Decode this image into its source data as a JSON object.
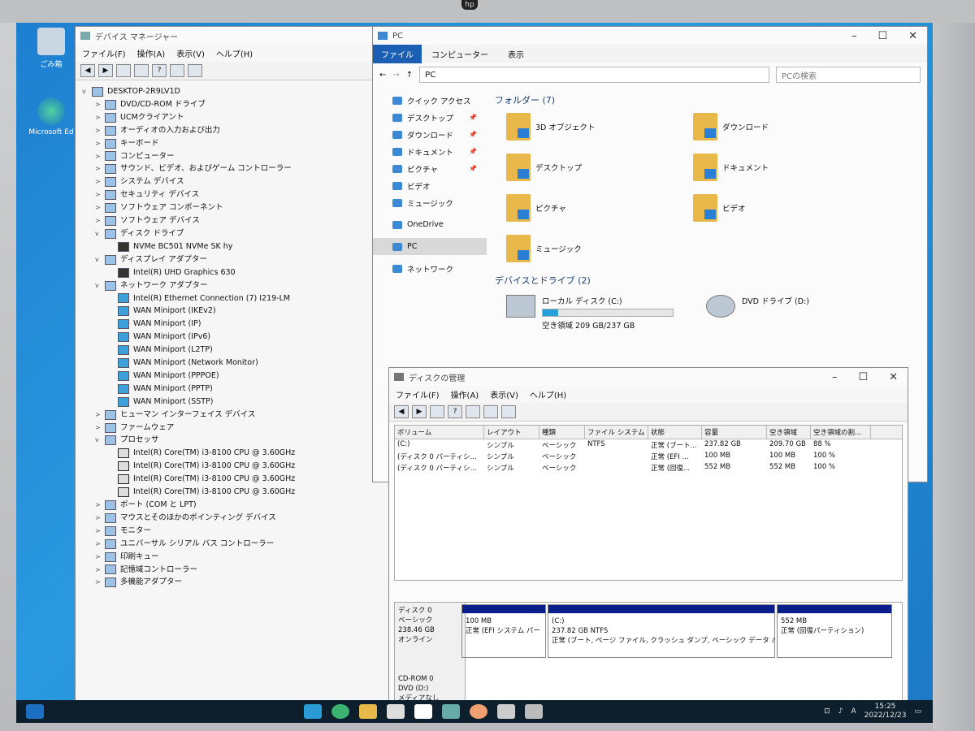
{
  "bezel": {
    "logo": "hp"
  },
  "desktop": {
    "icons": [
      {
        "label": "ごみ箱",
        "name": "recycle-bin"
      },
      {
        "label": "Microsoft Ed",
        "name": "microsoft-edge"
      }
    ]
  },
  "device_manager": {
    "title": "デバイス マネージャー",
    "menu": [
      "ファイル(F)",
      "操作(A)",
      "表示(V)",
      "ヘルプ(H)"
    ],
    "root": "DESKTOP-2R9LV1D",
    "tree": [
      {
        "exp": ">",
        "label": "DVD/CD-ROM ドライブ",
        "indent": 1
      },
      {
        "exp": ">",
        "label": "UCMクライアント",
        "indent": 1
      },
      {
        "exp": ">",
        "label": "オーディオの入力および出力",
        "indent": 1
      },
      {
        "exp": ">",
        "label": "キーボード",
        "indent": 1
      },
      {
        "exp": ">",
        "label": "コンピューター",
        "indent": 1
      },
      {
        "exp": ">",
        "label": "サウンド、ビデオ、およびゲーム コントローラー",
        "indent": 1
      },
      {
        "exp": ">",
        "label": "システム デバイス",
        "indent": 1
      },
      {
        "exp": ">",
        "label": "セキュリティ デバイス",
        "indent": 1
      },
      {
        "exp": ">",
        "label": "ソフトウェア コンポーネント",
        "indent": 1
      },
      {
        "exp": ">",
        "label": "ソフトウェア デバイス",
        "indent": 1
      },
      {
        "exp": "v",
        "label": "ディスク ドライブ",
        "indent": 1
      },
      {
        "exp": "",
        "label": "NVMe BC501 NVMe SK hy",
        "indent": 2
      },
      {
        "exp": "v",
        "label": "ディスプレイ アダプター",
        "indent": 1
      },
      {
        "exp": "",
        "label": "Intel(R) UHD Graphics 630",
        "indent": 2
      },
      {
        "exp": "v",
        "label": "ネットワーク アダプター",
        "indent": 1
      },
      {
        "exp": "",
        "label": "Intel(R) Ethernet Connection (7) I219-LM",
        "indent": 2
      },
      {
        "exp": "",
        "label": "WAN Miniport (IKEv2)",
        "indent": 2
      },
      {
        "exp": "",
        "label": "WAN Miniport (IP)",
        "indent": 2
      },
      {
        "exp": "",
        "label": "WAN Miniport (IPv6)",
        "indent": 2
      },
      {
        "exp": "",
        "label": "WAN Miniport (L2TP)",
        "indent": 2
      },
      {
        "exp": "",
        "label": "WAN Miniport (Network Monitor)",
        "indent": 2
      },
      {
        "exp": "",
        "label": "WAN Miniport (PPPOE)",
        "indent": 2
      },
      {
        "exp": "",
        "label": "WAN Miniport (PPTP)",
        "indent": 2
      },
      {
        "exp": "",
        "label": "WAN Miniport (SSTP)",
        "indent": 2
      },
      {
        "exp": ">",
        "label": "ヒューマン インターフェイス デバイス",
        "indent": 1
      },
      {
        "exp": ">",
        "label": "ファームウェア",
        "indent": 1
      },
      {
        "exp": "v",
        "label": "プロセッサ",
        "indent": 1
      },
      {
        "exp": "",
        "label": "Intel(R) Core(TM) i3-8100 CPU @ 3.60GHz",
        "indent": 2
      },
      {
        "exp": "",
        "label": "Intel(R) Core(TM) i3-8100 CPU @ 3.60GHz",
        "indent": 2
      },
      {
        "exp": "",
        "label": "Intel(R) Core(TM) i3-8100 CPU @ 3.60GHz",
        "indent": 2
      },
      {
        "exp": "",
        "label": "Intel(R) Core(TM) i3-8100 CPU @ 3.60GHz",
        "indent": 2
      },
      {
        "exp": ">",
        "label": "ポート (COM と LPT)",
        "indent": 1
      },
      {
        "exp": ">",
        "label": "マウスとそのほかのポインティング デバイス",
        "indent": 1
      },
      {
        "exp": ">",
        "label": "モニター",
        "indent": 1
      },
      {
        "exp": ">",
        "label": "ユニバーサル シリアル バス コントローラー",
        "indent": 1
      },
      {
        "exp": ">",
        "label": "印刷キュー",
        "indent": 1
      },
      {
        "exp": ">",
        "label": "記憶域コントローラー",
        "indent": 1
      },
      {
        "exp": ">",
        "label": "多機能アダプター",
        "indent": 1
      }
    ]
  },
  "explorer": {
    "title": "PC",
    "ribbon": [
      "ファイル",
      "コンピューター",
      "表示"
    ],
    "address": "PC",
    "search_placeholder": "PCの検索",
    "nav": [
      {
        "label": "クイック アクセス",
        "pin": false
      },
      {
        "label": "デスクトップ",
        "pin": true
      },
      {
        "label": "ダウンロード",
        "pin": true
      },
      {
        "label": "ドキュメント",
        "pin": true
      },
      {
        "label": "ピクチャ",
        "pin": true
      },
      {
        "label": "ビデオ",
        "pin": false
      },
      {
        "label": "ミュージック",
        "pin": false
      },
      {
        "label": "OneDrive",
        "pin": false
      },
      {
        "label": "PC",
        "pin": false
      },
      {
        "label": "ネットワーク",
        "pin": false
      }
    ],
    "folders_heading": "フォルダー (7)",
    "folders": [
      "3D オブジェクト",
      "ダウンロード",
      "デスクトップ",
      "ドキュメント",
      "ピクチャ",
      "ビデオ",
      "ミュージック"
    ],
    "drives_heading": "デバイスとドライブ (2)",
    "drives": [
      {
        "name": "ローカル ディスク (C:)",
        "free": "空き領域 209 GB/237 GB",
        "used_fraction": 0.12
      },
      {
        "name": "DVD ドライブ (D:)",
        "free": "",
        "used_fraction": null
      }
    ]
  },
  "disk_mgmt": {
    "title": "ディスクの管理",
    "menu": [
      "ファイル(F)",
      "操作(A)",
      "表示(V)",
      "ヘルプ(H)"
    ],
    "columns": [
      "ボリューム",
      "レイアウト",
      "種類",
      "ファイル システム",
      "状態",
      "容量",
      "空き領域",
      "空き領域の割..."
    ],
    "rows": [
      [
        "(C:)",
        "シンプル",
        "ベーシック",
        "NTFS",
        "正常 (ブート...",
        "237.82 GB",
        "209.70 GB",
        "88 %"
      ],
      [
        "(ディスク 0 パーティシ...",
        "シンプル",
        "ベーシック",
        "",
        "正常 (EFI ...",
        "100 MB",
        "100 MB",
        "100 %"
      ],
      [
        "(ディスク 0 パーティシ...",
        "シンプル",
        "ベーシック",
        "",
        "正常 (回復...",
        "552 MB",
        "552 MB",
        "100 %"
      ]
    ],
    "disk0": {
      "label": "ディスク 0",
      "type": "ベーシック",
      "size": "238.46 GB",
      "status": "オンライン"
    },
    "partitions": [
      {
        "title": "",
        "size": "100 MB",
        "status": "正常 (EFI システム パー"
      },
      {
        "title": "(C:)",
        "size": "237.82 GB NTFS",
        "status": "正常 (ブート, ページ ファイル, クラッシュ ダンプ, ベーシック データ パーティ"
      },
      {
        "title": "",
        "size": "552 MB",
        "status": "正常 (回復パーティション)"
      }
    ],
    "cdrom": {
      "label": "CD-ROM 0",
      "type": "DVD (D:)",
      "extra": "メディアなし"
    }
  },
  "taskbar": {
    "time": "15:25",
    "date": "2022/12/23",
    "ime": "A"
  }
}
